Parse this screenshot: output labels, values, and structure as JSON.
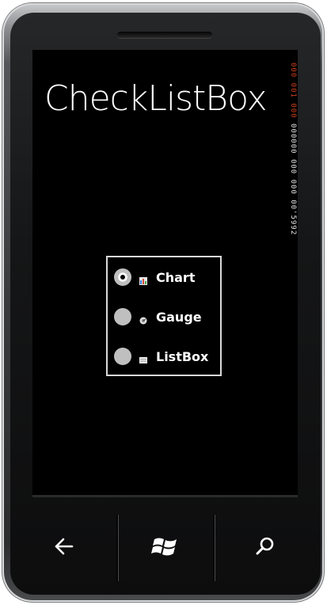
{
  "app": {
    "title": "CheckListBox",
    "counters": {
      "red": "000 001 000",
      "white": "000000 000 000 00'5992"
    }
  },
  "checklist": {
    "items": [
      {
        "label": "Chart",
        "checked": true,
        "icon": "chart-icon"
      },
      {
        "label": "Gauge",
        "checked": false,
        "icon": "gauge-icon"
      },
      {
        "label": "ListBox",
        "checked": false,
        "icon": "listbox-icon"
      }
    ]
  },
  "navbar": {
    "buttons": [
      {
        "icon": "back-arrow-icon"
      },
      {
        "icon": "windows-logo-icon"
      },
      {
        "icon": "search-icon"
      }
    ]
  },
  "colors": {
    "screen_background": "#000000",
    "text": "#ffffff",
    "radio_fill": "#bfbfbf",
    "list_border": "#d9d9d9",
    "counter_red": "#d1401e"
  }
}
